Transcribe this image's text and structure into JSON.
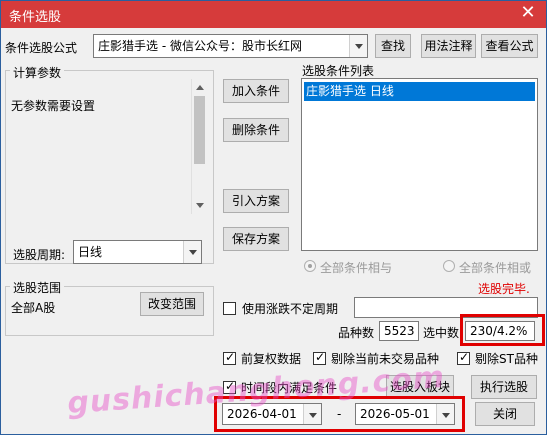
{
  "window": {
    "title": "条件选股"
  },
  "formula": {
    "label": "条件选股公式",
    "value": "庄影猎手选  -  微信公众号：股市长红网"
  },
  "buttons": {
    "find": "查找",
    "usage": "用法注释",
    "view_formula": "查看公式",
    "add_condition": "加入条件",
    "delete_condition": "删除条件",
    "import_scheme": "引入方案",
    "save_scheme": "保存方案",
    "change_range": "改变范围",
    "to_block": "选股入板块",
    "execute": "执行选股",
    "close": "关闭"
  },
  "params": {
    "group_label": "计算参数",
    "text": "无参数需要设置",
    "period_label": "选股周期:",
    "period_value": "日线"
  },
  "conditions": {
    "label": "选股条件列表",
    "items": [
      "庄影猎手选  日线"
    ]
  },
  "logic": {
    "and_label": "全部条件相与",
    "or_label": "全部条件相或"
  },
  "status": {
    "text": "选股完毕.",
    "color": "#e00000"
  },
  "range": {
    "group_label": "选股范围",
    "value": "全部A股"
  },
  "options": {
    "volatile_period": "使用涨跌不定周期",
    "forward_adjust": "前复权数据",
    "exclude_untraded": "剔除当前未交易品种",
    "exclude_st": "剔除ST品种",
    "time_condition": "时间段内满足条件"
  },
  "counts": {
    "total_label": "品种数",
    "total_value": "5523",
    "selected_label": "选中数",
    "selected_value": "230/4.2%"
  },
  "dates": {
    "start": "2026-04-01",
    "separator": "-",
    "end": "2026-05-01"
  },
  "watermark": "gushichanghong.com",
  "colors": {
    "title_bar": "#d63b3b",
    "selection": "#0078d7",
    "highlight_box": "#e00000"
  }
}
